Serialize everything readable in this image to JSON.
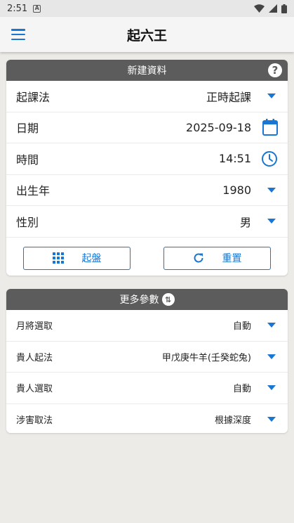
{
  "status": {
    "time": "2:51",
    "notif": "A"
  },
  "app_bar": {
    "title": "起六王"
  },
  "card1": {
    "header": "新建資料",
    "help": "?",
    "rows": [
      {
        "label": "起課法",
        "value": "正時起課",
        "control": "dropdown"
      },
      {
        "label": "日期",
        "value": "2025-09-18",
        "control": "calendar"
      },
      {
        "label": "時間",
        "value": "14:51",
        "control": "clock"
      },
      {
        "label": "出生年",
        "value": "1980",
        "control": "dropdown"
      },
      {
        "label": "性別",
        "value": "男",
        "control": "dropdown"
      }
    ],
    "buttons": {
      "start_label": "起盤",
      "reset_label": "重置"
    }
  },
  "card2": {
    "header": "更多參數",
    "rows": [
      {
        "label": "月將選取",
        "value": "自動"
      },
      {
        "label": "貴人起法",
        "value": "甲戊庚牛羊(壬癸蛇兔)"
      },
      {
        "label": "貴人選取",
        "value": "自動"
      },
      {
        "label": "涉害取法",
        "value": "根據深度"
      }
    ]
  },
  "colors": {
    "accent": "#1976d2",
    "header_bg": "#5c5c5c",
    "page_bg": "#ecebe8"
  },
  "icons": [
    "menu-icon",
    "help-icon",
    "calendar-icon",
    "clock-icon",
    "grid-icon",
    "refresh-icon",
    "swap-icon",
    "dropdown-arrow-icon",
    "wifi-icon",
    "signal-icon",
    "battery-icon"
  ]
}
